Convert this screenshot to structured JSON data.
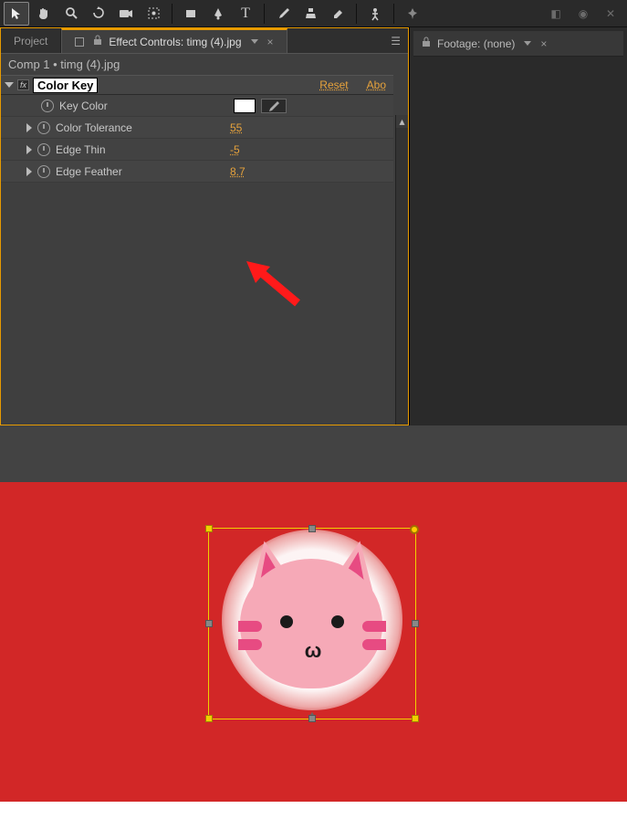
{
  "toolbar": {
    "tools": [
      "selection",
      "hand",
      "zoom",
      "rotate",
      "camera",
      "pan-behind",
      "rect",
      "pen",
      "text",
      "brush",
      "stamp",
      "eraser",
      "puppet",
      "pin"
    ]
  },
  "tabs": {
    "project_label": "Project",
    "active_label": "Effect Controls: timg (4).jpg"
  },
  "breadcrumb": "Comp 1 • timg (4).jpg",
  "effect": {
    "name": "Color Key",
    "reset": "Reset",
    "about": "Abo",
    "props": {
      "key_color_label": "Key Color",
      "tolerance_label": "Color Tolerance",
      "tolerance_value": "55",
      "edge_thin_label": "Edge Thin",
      "edge_thin_value": "-5",
      "edge_feather_label": "Edge Feather",
      "edge_feather_value": "8.7"
    }
  },
  "footage_panel": {
    "label": "Footage: (none)"
  }
}
